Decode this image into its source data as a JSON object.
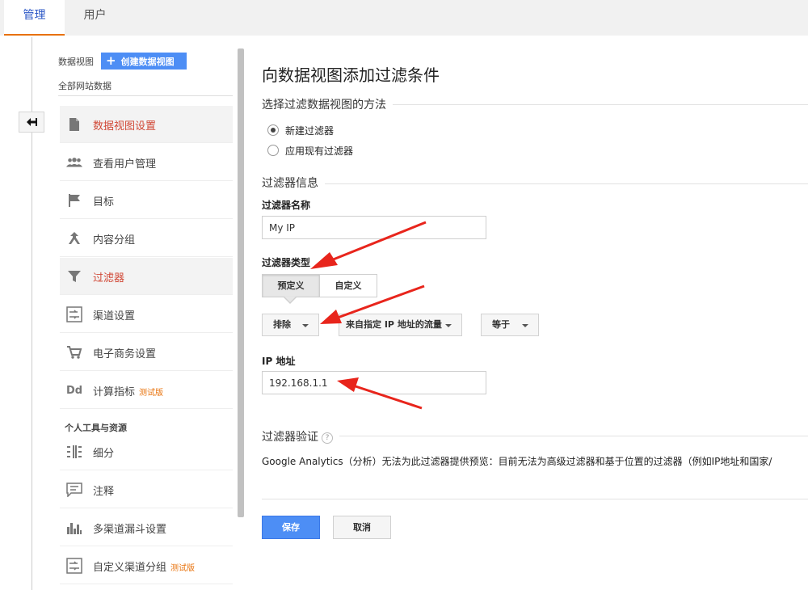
{
  "tabs": [
    {
      "label": "管理"
    },
    {
      "label": "用户"
    }
  ],
  "sidebar": {
    "view_label": "数据视图",
    "create_button_label": "创建数据视图",
    "view_name": "全部网站数据",
    "items": [
      {
        "label": "数据视图设置",
        "icon": "document-icon",
        "active": true
      },
      {
        "label": "查看用户管理",
        "icon": "people-icon"
      },
      {
        "label": "目标",
        "icon": "flag-icon"
      },
      {
        "label": "内容分组",
        "icon": "content-grouping-icon"
      },
      {
        "label": "过滤器",
        "icon": "filter-icon",
        "active": true
      },
      {
        "label": "渠道设置",
        "icon": "channel-icon"
      },
      {
        "label": "电子商务设置",
        "icon": "cart-icon"
      },
      {
        "label": "计算指标",
        "icon": "dd-icon",
        "badge": "测试版"
      }
    ],
    "personal_section_label": "个人工具与资源",
    "personal_items": [
      {
        "label": "细分",
        "icon": "segments-icon"
      },
      {
        "label": "注释",
        "icon": "annotation-icon"
      },
      {
        "label": "多渠道漏斗设置",
        "icon": "funnel-icon"
      },
      {
        "label": "自定义渠道分组",
        "icon": "channel-icon",
        "badge": "测试版"
      }
    ]
  },
  "main": {
    "title": "向数据视图添加过滤条件",
    "method_section": "选择过滤数据视图的方法",
    "radio_options": [
      {
        "label": "新建过滤器",
        "checked": true
      },
      {
        "label": "应用现有过滤器",
        "checked": false
      }
    ],
    "info_section": "过滤器信息",
    "name_label": "过滤器名称",
    "name_value": "My IP",
    "type_label": "过滤器类型",
    "type_tabs": [
      {
        "label": "预定义",
        "selected": true
      },
      {
        "label": "自定义",
        "selected": false
      }
    ],
    "dropdowns": [
      {
        "value": "排除"
      },
      {
        "value": "来自指定 IP 地址的流量"
      },
      {
        "value": "等于"
      }
    ],
    "ip_label": "IP 地址",
    "ip_value": "192.168.1.1",
    "verify_section": "过滤器验证",
    "verify_help": "?",
    "verify_text": "Google Analytics（分析）无法为此过滤器提供预览：目前无法为高级过滤器和基于位置的过滤器（例如IP地址和国家/",
    "save_label": "保存",
    "cancel_label": "取消"
  },
  "colors": {
    "accent_blue": "#4d8ef5",
    "active_red": "#d14836",
    "tab_underline": "#e8710a",
    "arrow_red": "#e8251c"
  }
}
